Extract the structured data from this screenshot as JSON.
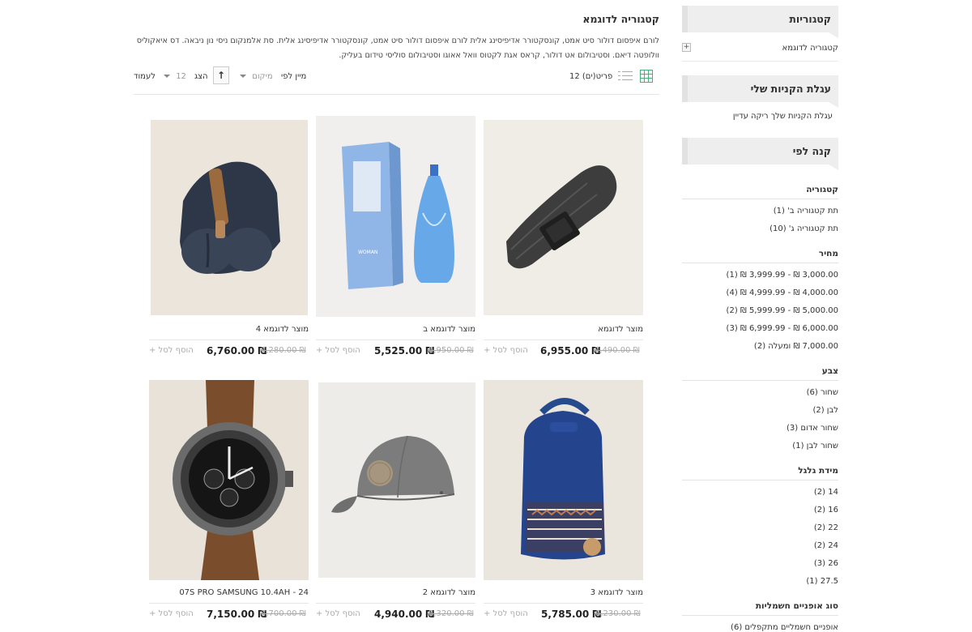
{
  "sidebar": {
    "categories": {
      "title": "קטגוריות",
      "item_label": "קטגוריה לדוגמא",
      "expand_glyph": "+"
    },
    "cart": {
      "title": "עגלת הקניות שלי",
      "empty_text": "עגלת הקניות שלך ריקה עדיין"
    },
    "shop_by": {
      "title": "קנה לפי",
      "filters": [
        {
          "heading": "קטגוריה",
          "options": [
            "תת קטגוריה ב' (1)",
            "תת קטגוריה ג' (10)"
          ]
        },
        {
          "heading": "מחיר",
          "options": [
            "3,000.00 ₪ - 3,999.99 ₪ (1)",
            "4,000.00 ₪ - 4,999.99 ₪ (4)",
            "5,000.00 ₪ - 5,999.99 ₪ (2)",
            "6,000.00 ₪ - 6,999.99 ₪ (3)",
            "7,000.00 ₪ ומעלה (2)"
          ]
        },
        {
          "heading": "צבע",
          "options": [
            "שחור (6)",
            "לבן (2)",
            "שחור אדום (3)",
            "שחור לבן (1)"
          ]
        },
        {
          "heading": "מידת גלגל",
          "options": [
            "14 (2)",
            "16 (2)",
            "22 (2)",
            "24 (2)",
            "26 (3)",
            "27.5 (1)"
          ]
        },
        {
          "heading": "סוג אופניים חשמליות",
          "options": [
            "אופניים חשמליים מתקפלים (6)"
          ]
        }
      ]
    }
  },
  "main": {
    "title": "קטגוריה לדוגמא",
    "description_line1": "לורם איפסום דולור סיט אמט, קונסקטורר אדיפיסינג אלית לורם איפסום דולור סיט אמט, קונסקטורר אדיפיסינג אלית. סת אלמנקום ניסי נון ניבאה. דס איאקוליס",
    "description_line2": "וולופטה דיאם. וסטיבולום אט דולור, קראס אגת לקטוס וואל אאוגו וסטיבולום סוליסי טידום בעליק.",
    "toolbar": {
      "count": "12 פריט(ים)",
      "sort_label": "מיין לפי",
      "sort_value": "מיקום",
      "sort_direction_glyph": "↑",
      "show_label": "הצג",
      "per_page_value": "12",
      "per_page_suffix": "לעמוד"
    },
    "products": [
      {
        "name": "מוצר לדוגמא",
        "old_price": "7,490.00 ₪",
        "price": "6,955.00 ₪",
        "add_label": "הוסף לסל +",
        "image": "belt"
      },
      {
        "name": "מוצר לדוגמא ב",
        "old_price": "5,950.00 ₪",
        "price": "5,525.00 ₪",
        "add_label": "הוסף לסל +",
        "image": "perfume"
      },
      {
        "name": "מוצר לדוגמא 4",
        "old_price": "7,280.00 ₪",
        "price": "6,760.00 ₪",
        "add_label": "הוסף לסל +",
        "image": "toiletry-roll"
      },
      {
        "name": "מוצר לדוגמא 3",
        "old_price": "6,230.00 ₪",
        "price": "5,785.00 ₪",
        "add_label": "הוסף לסל +",
        "image": "backpack"
      },
      {
        "name": "מוצר לדוגמא 2",
        "old_price": "5,320.00 ₪",
        "price": "4,940.00 ₪",
        "add_label": "הוסף לסל +",
        "image": "cap"
      },
      {
        "name": "07S PRO SAMSUNG 10.4AH - 24",
        "old_price": "7,700.00 ₪",
        "price": "7,150.00 ₪",
        "add_label": "הוסף לסל +",
        "image": "watch"
      }
    ],
    "perfume_box_text": "WOMAN"
  }
}
